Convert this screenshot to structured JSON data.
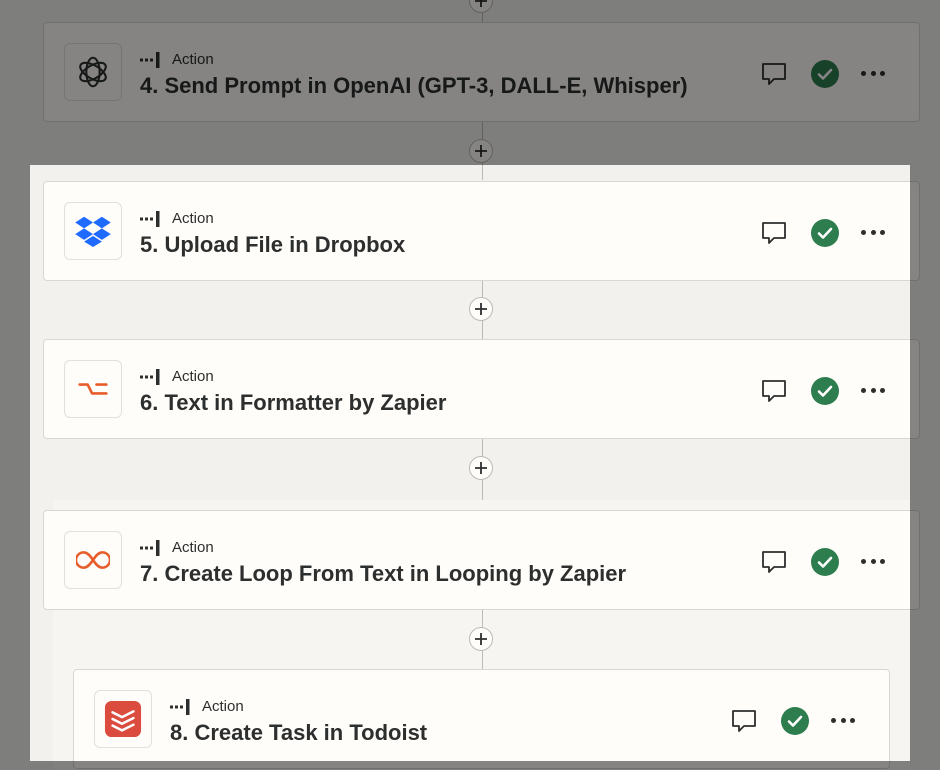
{
  "steps": [
    {
      "number_title": "4. Send Prompt in OpenAI (GPT-3, DALL-E, Whisper)",
      "type_label": "Action",
      "app_icon": "openai-icon",
      "status": "complete"
    },
    {
      "number_title": "5. Upload File in Dropbox",
      "type_label": "Action",
      "app_icon": "dropbox-icon",
      "status": "complete"
    },
    {
      "number_title": "6. Text in Formatter by Zapier",
      "type_label": "Action",
      "app_icon": "formatter-icon",
      "status": "complete"
    },
    {
      "number_title": "7. Create Loop From Text in Looping by Zapier",
      "type_label": "Action",
      "app_icon": "looping-icon",
      "status": "complete"
    },
    {
      "number_title": "8. Create Task in Todoist",
      "type_label": "Action",
      "app_icon": "todoist-icon",
      "status": "complete"
    }
  ],
  "colors": {
    "success": "#2e7d4f",
    "dropbox": "#1f6bff",
    "zapier_orange": "#e85d2c",
    "todoist": "#db4c3f",
    "text": "#2d2e2e"
  }
}
